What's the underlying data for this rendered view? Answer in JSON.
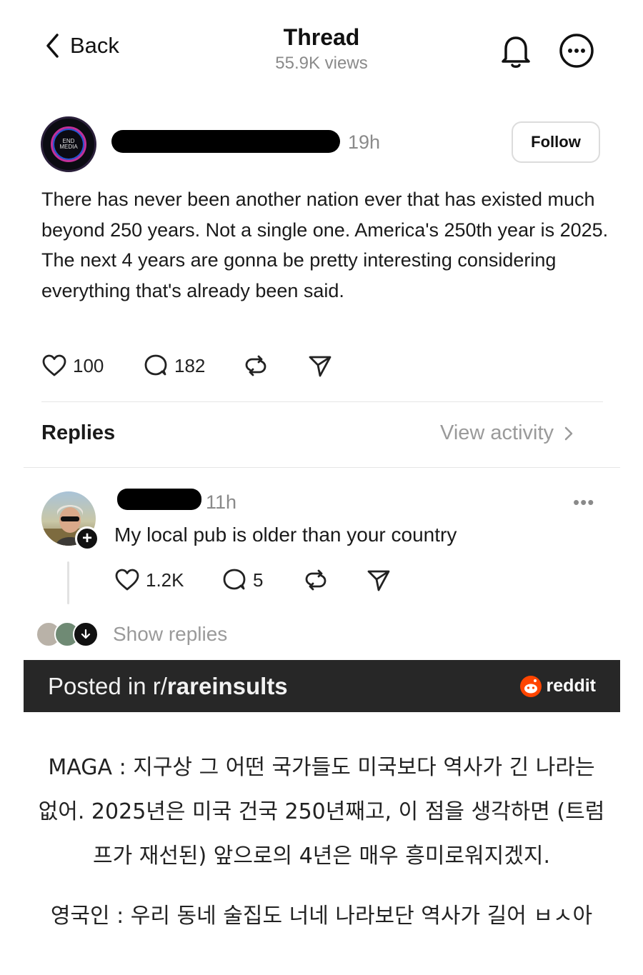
{
  "header": {
    "back_label": "Back",
    "title": "Thread",
    "views": "55.9K views"
  },
  "post": {
    "avatar_text": "END MEDIA",
    "time": "19h",
    "follow_label": "Follow",
    "text": "There has never been another nation ever that has existed much beyond 250 years. Not a single one. America's 250th year is 2025. The next 4 years are gonna be pretty interesting considering everything that's already been said.",
    "likes": "100",
    "comments": "182"
  },
  "replies_section": {
    "label": "Replies",
    "view_activity": "View activity"
  },
  "reply": {
    "time": "11h",
    "more": "•••",
    "text": "My local pub is older than your country",
    "likes": "1.2K",
    "comments": "5",
    "show_replies": "Show replies"
  },
  "banner": {
    "posted_in": "Posted in r/",
    "subreddit": "rareinsults",
    "brand": "reddit"
  },
  "caption": {
    "line1": "MAGA : 지구상 그 어떤 국가들도 미국보다 역사가 긴 나라는",
    "line2": "없어. 2025년은 미국 건국 250년째고, 이 점을 생각하면 (트럼",
    "line3": "프가 재선된) 앞으로의 4년은 매우 흥미로워지겠지.",
    "line4": "영국인 : 우리 동네 술집도 너네 나라보단 역사가 길어 ㅂㅅ아"
  },
  "colors": {
    "banner_bg": "#272727",
    "reddit_orange": "#ff4500",
    "muted_text": "#8a8a8a"
  }
}
